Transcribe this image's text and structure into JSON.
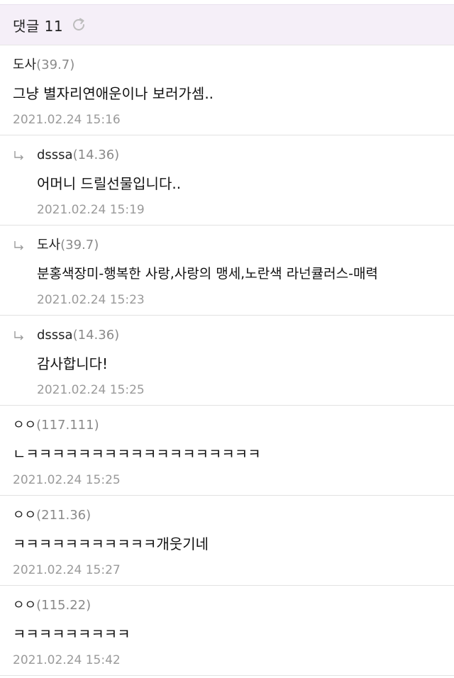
{
  "header": {
    "title": "댓글 11"
  },
  "comments": [
    {
      "author": "도사",
      "ip": "(39.7)",
      "text": "그냥 별자리연애운이나 보러가셈..",
      "date": "2021.02.24 15:16",
      "reply": false
    },
    {
      "author": "dsssa",
      "ip": "(14.36)",
      "text": "어머니 드릴선물입니다..",
      "date": "2021.02.24 15:19",
      "reply": true
    },
    {
      "author": "도사",
      "ip": "(39.7)",
      "text": "분홍색장미-행복한 사랑,사랑의 맹세,노란색 라넌큘러스-매력",
      "date": "2021.02.24 15:23",
      "reply": true
    },
    {
      "author": "dsssa",
      "ip": "(14.36)",
      "text": "감사합니다!",
      "date": "2021.02.24 15:25",
      "reply": true
    },
    {
      "author": "ㅇㅇ",
      "ip": "(117.111)",
      "text": "ㄴㅋㅋㅋㅋㅋㅋㅋㅋㅋㅋㅋㅋㅋㅋㅋㅋㅋㅋ",
      "date": "2021.02.24 15:25",
      "reply": false
    },
    {
      "author": "ㅇㅇ",
      "ip": "(211.36)",
      "text": "ㅋㅋㅋㅋㅋㅋㅋㅋㅋㅋㅋ개웃기네",
      "date": "2021.02.24 15:27",
      "reply": false
    },
    {
      "author": "ㅇㅇ",
      "ip": "(115.22)",
      "text": "ㅋㅋㅋㅋㅋㅋㅋㅋㅋ",
      "date": "2021.02.24 15:42",
      "reply": false
    }
  ]
}
